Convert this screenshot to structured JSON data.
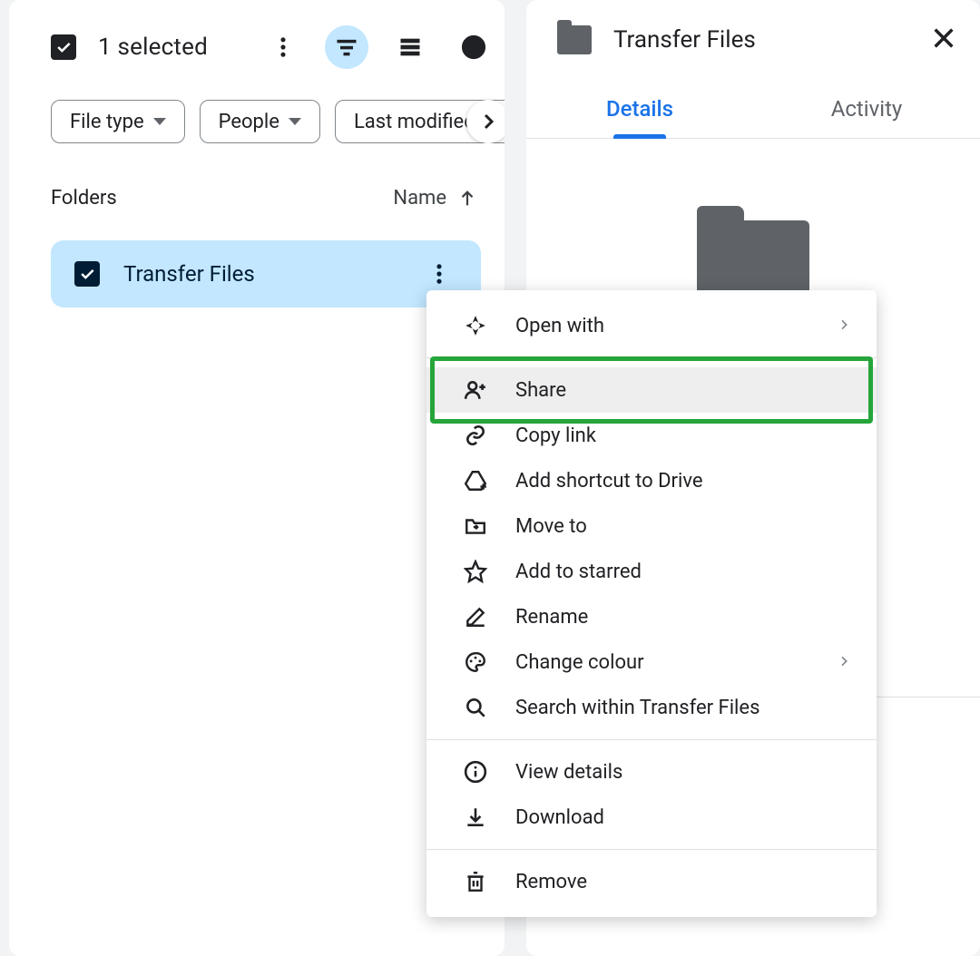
{
  "left": {
    "selection_text": "1 selected",
    "chips": [
      "File type",
      "People",
      "Last modified"
    ],
    "folders_label": "Folders",
    "sort_label": "Name",
    "rows": [
      {
        "name": "Transfer Files"
      }
    ]
  },
  "right": {
    "title": "Transfer Files",
    "tabs": {
      "details": "Details",
      "activity": "Activity"
    }
  },
  "context_menu": {
    "open_with": "Open with",
    "share": "Share",
    "copy_link": "Copy link",
    "add_shortcut": "Add shortcut to Drive",
    "move_to": "Move to",
    "add_starred": "Add to starred",
    "rename": "Rename",
    "change_colour": "Change colour",
    "search_within": "Search within Transfer Files",
    "view_details": "View details",
    "download": "Download",
    "remove": "Remove"
  }
}
